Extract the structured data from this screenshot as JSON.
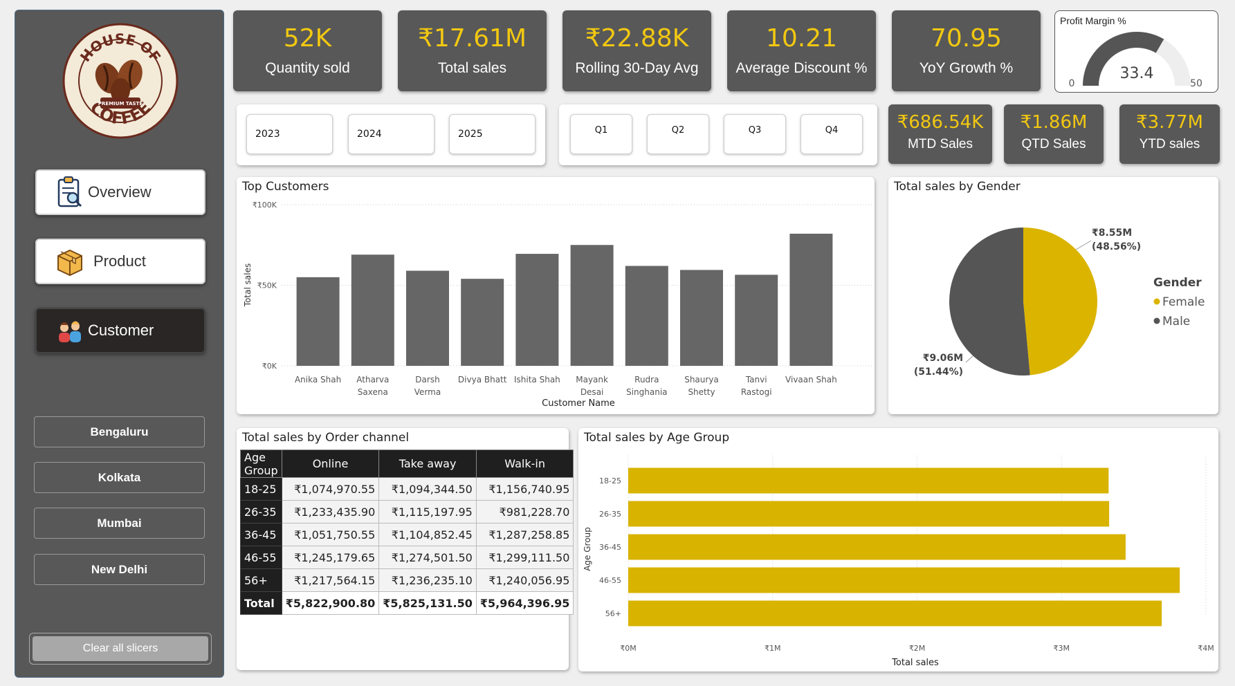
{
  "brand": {
    "logo_top": "HOUSE OF",
    "logo_bottom": "COFFEE",
    "logo_badge": "PREMIUM TASTE"
  },
  "nav": {
    "overview": "Overview",
    "product": "Product",
    "customer": "Customer"
  },
  "cities": [
    "Bengaluru",
    "Kolkata",
    "Mumbai",
    "New Delhi"
  ],
  "clear_label": "Clear all slicers",
  "kpis": [
    {
      "value": "52K",
      "label": "Quantity sold"
    },
    {
      "value": "₹17.61M",
      "label": "Total sales"
    },
    {
      "value": "₹22.88K",
      "label": "Rolling 30-Day Avg"
    },
    {
      "value": "10.21",
      "label": "Average Discount %"
    },
    {
      "value": "70.95",
      "label": "YoY Growth %"
    }
  ],
  "gauge": {
    "title": "Profit Margin %",
    "value": "33.4",
    "min": "0",
    "max": "50",
    "fraction": 0.668
  },
  "period_kpis": [
    {
      "value": "₹686.54K",
      "label": "MTD Sales"
    },
    {
      "value": "₹1.86M",
      "label": "QTD Sales"
    },
    {
      "value": "₹3.77M",
      "label": "YTD sales"
    }
  ],
  "years": [
    "2023",
    "2024",
    "2025"
  ],
  "quarters": [
    "Q1",
    "Q2",
    "Q3",
    "Q4"
  ],
  "top_customers": {
    "title": "Top Customers",
    "ylabel": "Total sales",
    "xlabel": "Customer Name",
    "yticks": [
      "₹100K",
      "₹50K",
      "₹0K"
    ]
  },
  "gender": {
    "title": "Total sales by Gender",
    "legend_title": "Gender",
    "female_label": "₹8.55M",
    "female_pct": "(48.56%)",
    "male_label": "₹9.06M",
    "male_pct": "(51.44%)"
  },
  "channel_table": {
    "title": "Total sales by Order channel",
    "headers": [
      "Age Group",
      "Online",
      "Take away",
      "Walk-in"
    ],
    "rows": [
      [
        "18-25",
        "₹1,074,970.55",
        "₹1,094,344.50",
        "₹1,156,740.95"
      ],
      [
        "26-35",
        "₹1,233,435.90",
        "₹1,115,197.95",
        "₹981,228.70"
      ],
      [
        "36-45",
        "₹1,051,750.55",
        "₹1,104,852.45",
        "₹1,287,258.85"
      ],
      [
        "46-55",
        "₹1,245,179.65",
        "₹1,274,501.50",
        "₹1,299,111.50"
      ],
      [
        "56+",
        "₹1,217,564.15",
        "₹1,236,235.10",
        "₹1,240,056.95"
      ]
    ],
    "total": [
      "Total",
      "₹5,822,900.80",
      "₹5,825,131.50",
      "₹5,964,396.95"
    ]
  },
  "age_group": {
    "title": "Total sales by Age Group",
    "ylabel": "Age Group",
    "xlabel": "Total sales",
    "xticks": [
      "₹0M",
      "₹1M",
      "₹2M",
      "₹3M",
      "₹4M"
    ]
  },
  "colors": {
    "accent": "#f2c811",
    "bar_gray": "#666666",
    "male": "#555555",
    "female": "#dbb400",
    "age_bar": "#d8b300"
  },
  "chart_data": [
    {
      "type": "bar",
      "title": "Top Customers",
      "xlabel": "Customer Name",
      "ylabel": "Total sales",
      "categories": [
        "Anika Shah",
        "Atharva Saxena",
        "Darsh Verma",
        "Divya Bhatt",
        "Ishita Shah",
        "Mayank Desai",
        "Rudra Singhania",
        "Shaurya Shetty",
        "Tanvi Rastogi",
        "Vivaan Shah"
      ],
      "values": [
        55000,
        69000,
        59000,
        54000,
        69500,
        75000,
        62000,
        59500,
        56500,
        82000
      ],
      "ylim": [
        0,
        100000
      ],
      "grid": true
    },
    {
      "type": "pie",
      "title": "Total sales by Gender",
      "categories": [
        "Female",
        "Male"
      ],
      "values": [
        8550000,
        9060000
      ],
      "percent": [
        48.56,
        51.44
      ],
      "legend": "right"
    },
    {
      "type": "bar",
      "orientation": "horizontal",
      "title": "Total sales by Age Group",
      "xlabel": "Total sales",
      "ylabel": "Age Group",
      "categories": [
        "18-25",
        "26-35",
        "36-45",
        "46-55",
        "56+"
      ],
      "values": [
        3326056,
        3329862,
        3443862,
        3818793,
        3693856
      ],
      "xlim": [
        0,
        4000000
      ]
    }
  ]
}
